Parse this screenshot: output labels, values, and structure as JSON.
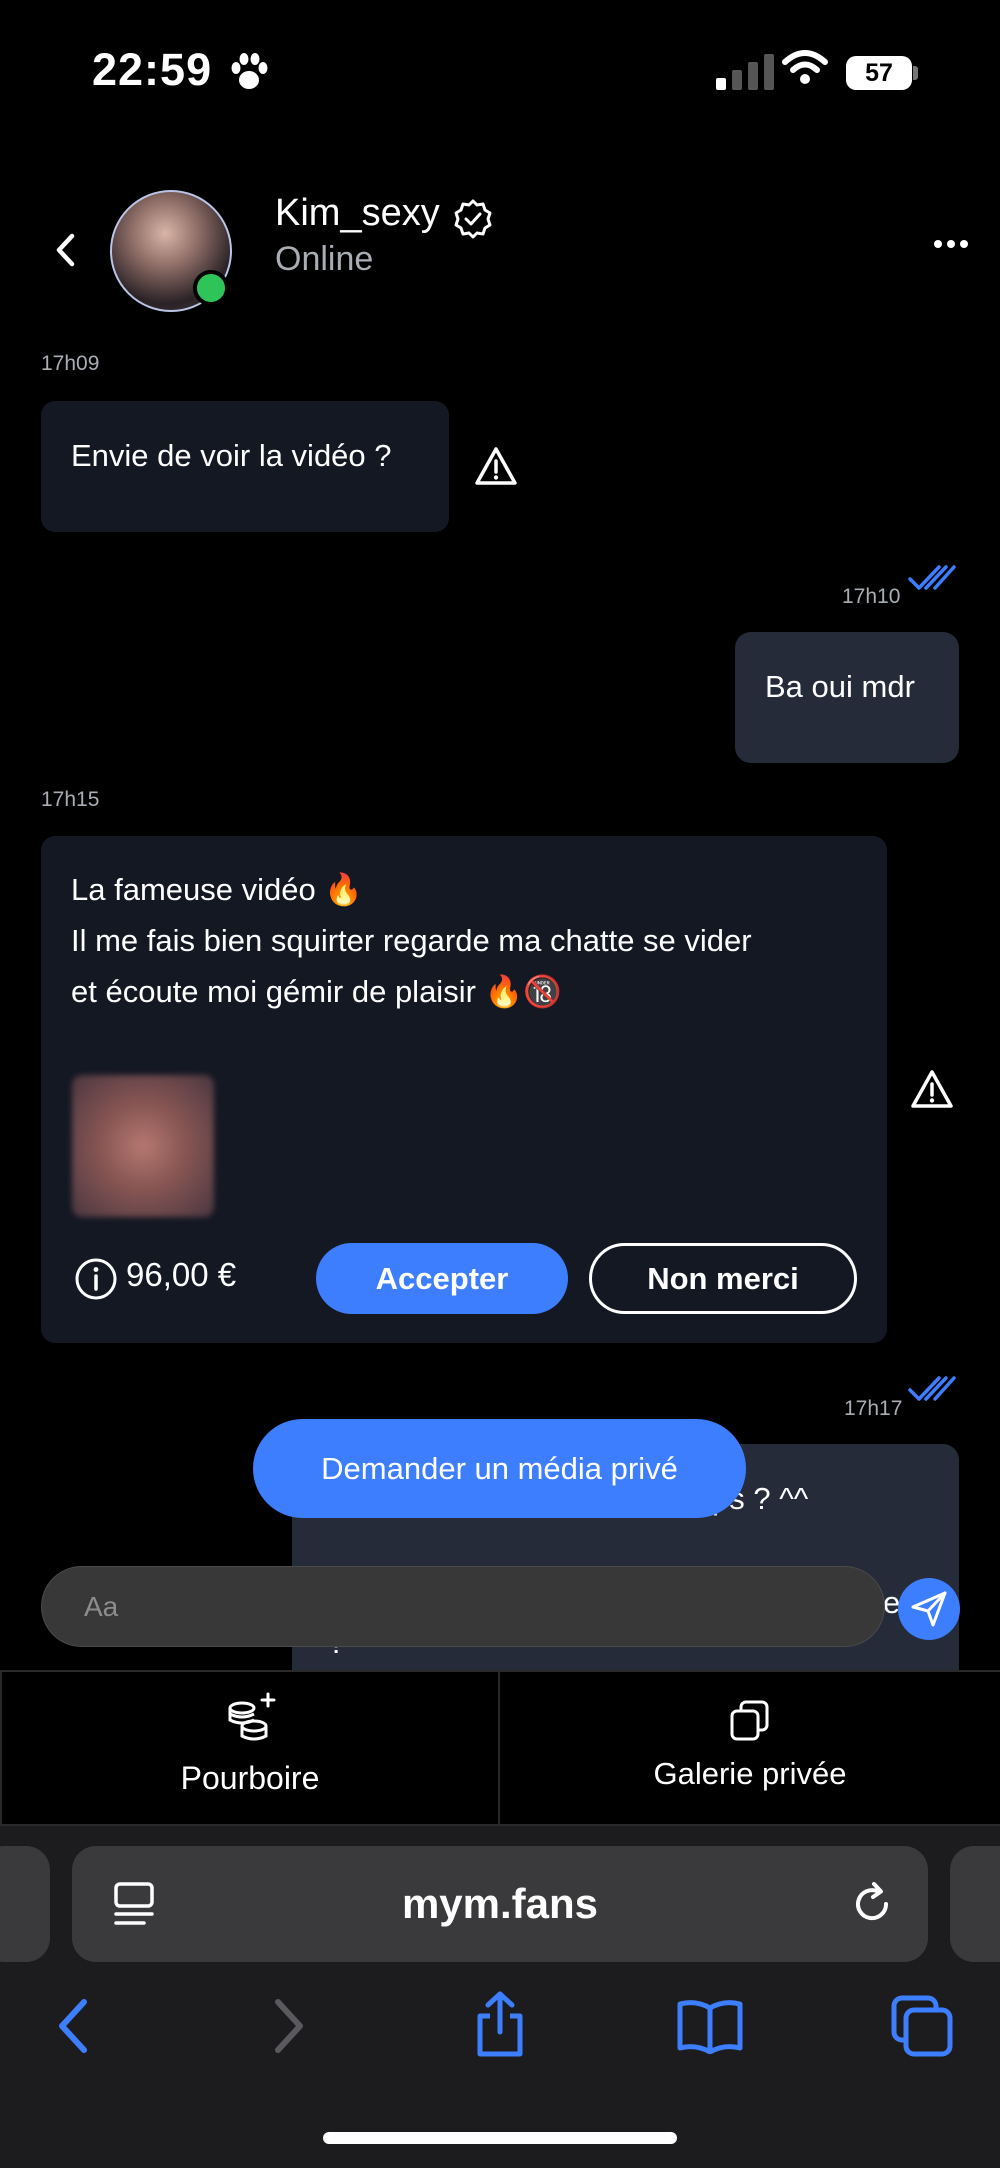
{
  "status_bar": {
    "time": "22:59",
    "battery": "57"
  },
  "header": {
    "name": "Kim_sexy",
    "status": "Online"
  },
  "messages": [
    {
      "time": "17h09",
      "text": "Envie de voir la vidéo ?"
    },
    {
      "time": "17h10",
      "text": "Ba oui mdr"
    },
    {
      "time": "17h15",
      "lines": [
        "La fameuse vidéo 🔥",
        "Il me fais bien squirter regarde ma chatte se vider",
        "et écoute moi gémir de plaisir 🔥🔞"
      ],
      "price": "96,00 €",
      "accept_label": "Accepter",
      "decline_label": "Non merci"
    },
    {
      "time": "17h17",
      "partial_text": "ps ? ^^",
      "partial_text_2": "e",
      "partial_text_3": "?"
    }
  ],
  "request_button": "Demander un média privé",
  "composer": {
    "placeholder": "Aa"
  },
  "tabs": {
    "tip": "Pourboire",
    "gallery": "Galerie privée"
  },
  "browser": {
    "url": "mym.fans"
  },
  "colors": {
    "accent": "#3d7eff",
    "online": "#2fc45a",
    "bubble_in": "#141823",
    "bubble_out": "#252b38"
  },
  "icons": [
    "paw-icon",
    "signal-icon",
    "wifi-icon",
    "battery-icon",
    "back-chevron-icon",
    "verified-badge-icon",
    "more-icon",
    "warning-icon",
    "double-check-icon",
    "info-icon",
    "send-icon",
    "coins-plus-icon",
    "copy-gallery-icon",
    "tab-overview-icon",
    "reload-icon",
    "browser-back-icon",
    "browser-forward-icon",
    "share-icon",
    "bookmarks-icon",
    "tabs-icon"
  ]
}
